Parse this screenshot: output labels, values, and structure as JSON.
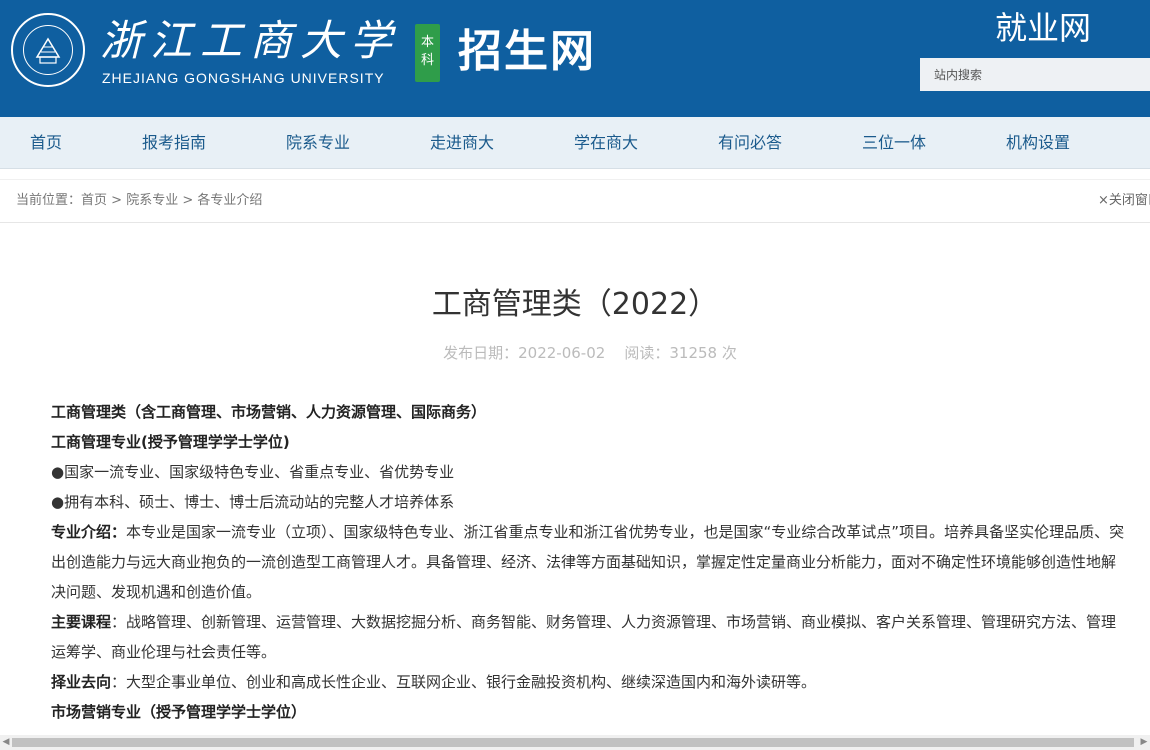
{
  "header": {
    "university_name_cn": "浙江工商大学",
    "university_name_en": "ZHEJIANG GONGSHANG UNIVERSITY",
    "badge": "本科",
    "site_name": "招生网",
    "jobs_link": "就业网",
    "search_placeholder": "站内搜索"
  },
  "nav": {
    "items": [
      "首页",
      "报考指南",
      "院系专业",
      "走进商大",
      "学在商大",
      "有问必答",
      "三位一体",
      "机构设置"
    ]
  },
  "breadcrumb": {
    "prefix": "当前位置：",
    "items": [
      "首页",
      "院系专业",
      "各专业介绍"
    ],
    "separator": " > ",
    "close_label": "×关闭窗口"
  },
  "article": {
    "title": "工商管理类（2022）",
    "meta": "发布日期：2022-06-02    阅读：31258 次",
    "lines": [
      {
        "bold": "工商管理类（含工商管理、市场营销、人力资源管理、国际商务）",
        "text": ""
      },
      {
        "bold": "工商管理专业(授予管理学学士学位)",
        "text": ""
      },
      {
        "bold": "",
        "text": "●国家一流专业、国家级特色专业、省重点专业、省优势专业"
      },
      {
        "bold": "",
        "text": "●拥有本科、硕士、博士、博士后流动站的完整人才培养体系"
      },
      {
        "bold": "专业介绍：",
        "text": "本专业是国家一流专业（立项）、国家级特色专业、浙江省重点专业和浙江省优势专业，也是国家“专业综合改革试点”项目。培养具备坚实伦理品质、突出创造能力与远大商业抱负的一流创造型工商管理人才。具备管理、经济、法律等方面基础知识，掌握定性定量商业分析能力，面对不确定性环境能够创造性地解决问题、发现机遇和创造价值。"
      },
      {
        "bold": "主要课程",
        "text": "：战略管理、创新管理、运营管理、大数据挖掘分析、商务智能、财务管理、人力资源管理、市场营销、商业模拟、客户关系管理、管理研究方法、管理运筹学、商业伦理与社会责任等。"
      },
      {
        "bold": "择业去向",
        "text": "：大型企事业单位、创业和高成长性企业、互联网企业、银行金融投资机构、继续深造国内和海外读研等。"
      },
      {
        "bold": "市场营销专业（授予管理学学士学位）",
        "text": ""
      }
    ]
  },
  "colors": {
    "header_bg": "#0f5fa0",
    "nav_bg": "#e8f0f6",
    "nav_text": "#1a5a8c",
    "badge_bg": "#2f9d4a"
  }
}
